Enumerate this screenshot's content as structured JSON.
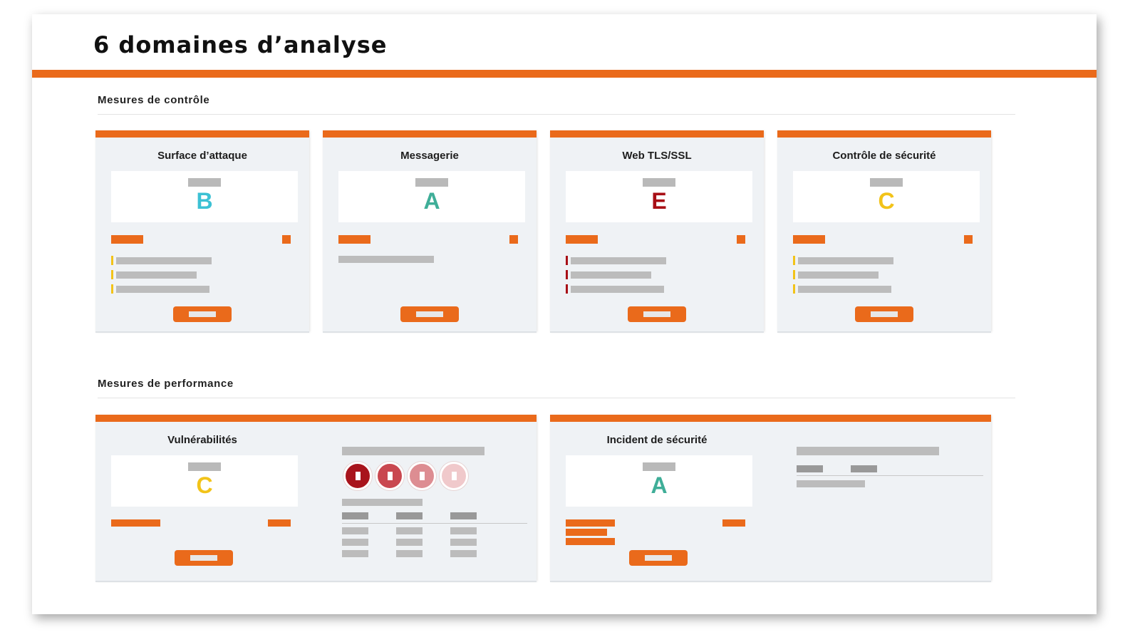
{
  "page": {
    "title": "6 domaines d’analyse"
  },
  "sections": {
    "control": {
      "label": "Mesures de contrôle"
    },
    "performance": {
      "label": "Mesures de performance"
    }
  },
  "colors": {
    "accent": "#ea6a1b",
    "grade_A": "#3fae98",
    "grade_B": "#3cc1d4",
    "grade_C": "#f2c319",
    "grade_E": "#a80f16",
    "severity": [
      "#a8141c",
      "#c9474f",
      "#dd8d92",
      "#f0c9cb"
    ]
  },
  "cards": {
    "surface": {
      "title": "Surface d’attaque",
      "grade": "B"
    },
    "messaging": {
      "title": "Messagerie",
      "grade": "A"
    },
    "web": {
      "title": "Web TLS/SSL",
      "grade": "E"
    },
    "security_control": {
      "title": "Contrôle de sécurité",
      "grade": "C"
    },
    "vulnerabilities": {
      "title": "Vulnérabilités",
      "grade": "C"
    },
    "incident": {
      "title": "Incident de sécurité",
      "grade": "A"
    }
  }
}
